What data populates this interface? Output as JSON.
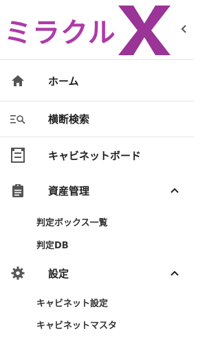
{
  "logo": {
    "text": "ミラクル",
    "mark": "X"
  },
  "nav": {
    "home": "ホーム",
    "search": "横断検索",
    "cabinet_board": "キャビネットボード",
    "asset_management": "資産管理",
    "settings": "設定"
  },
  "asset_sub": [
    "判定ボックス一覧",
    "判定DB"
  ],
  "settings_sub": [
    "キャビネット設定",
    "キャビネットマスタ"
  ],
  "colors": {
    "brand": "#ae3aa9",
    "brand_dark": "#8f2f93",
    "icon": "#555555"
  }
}
